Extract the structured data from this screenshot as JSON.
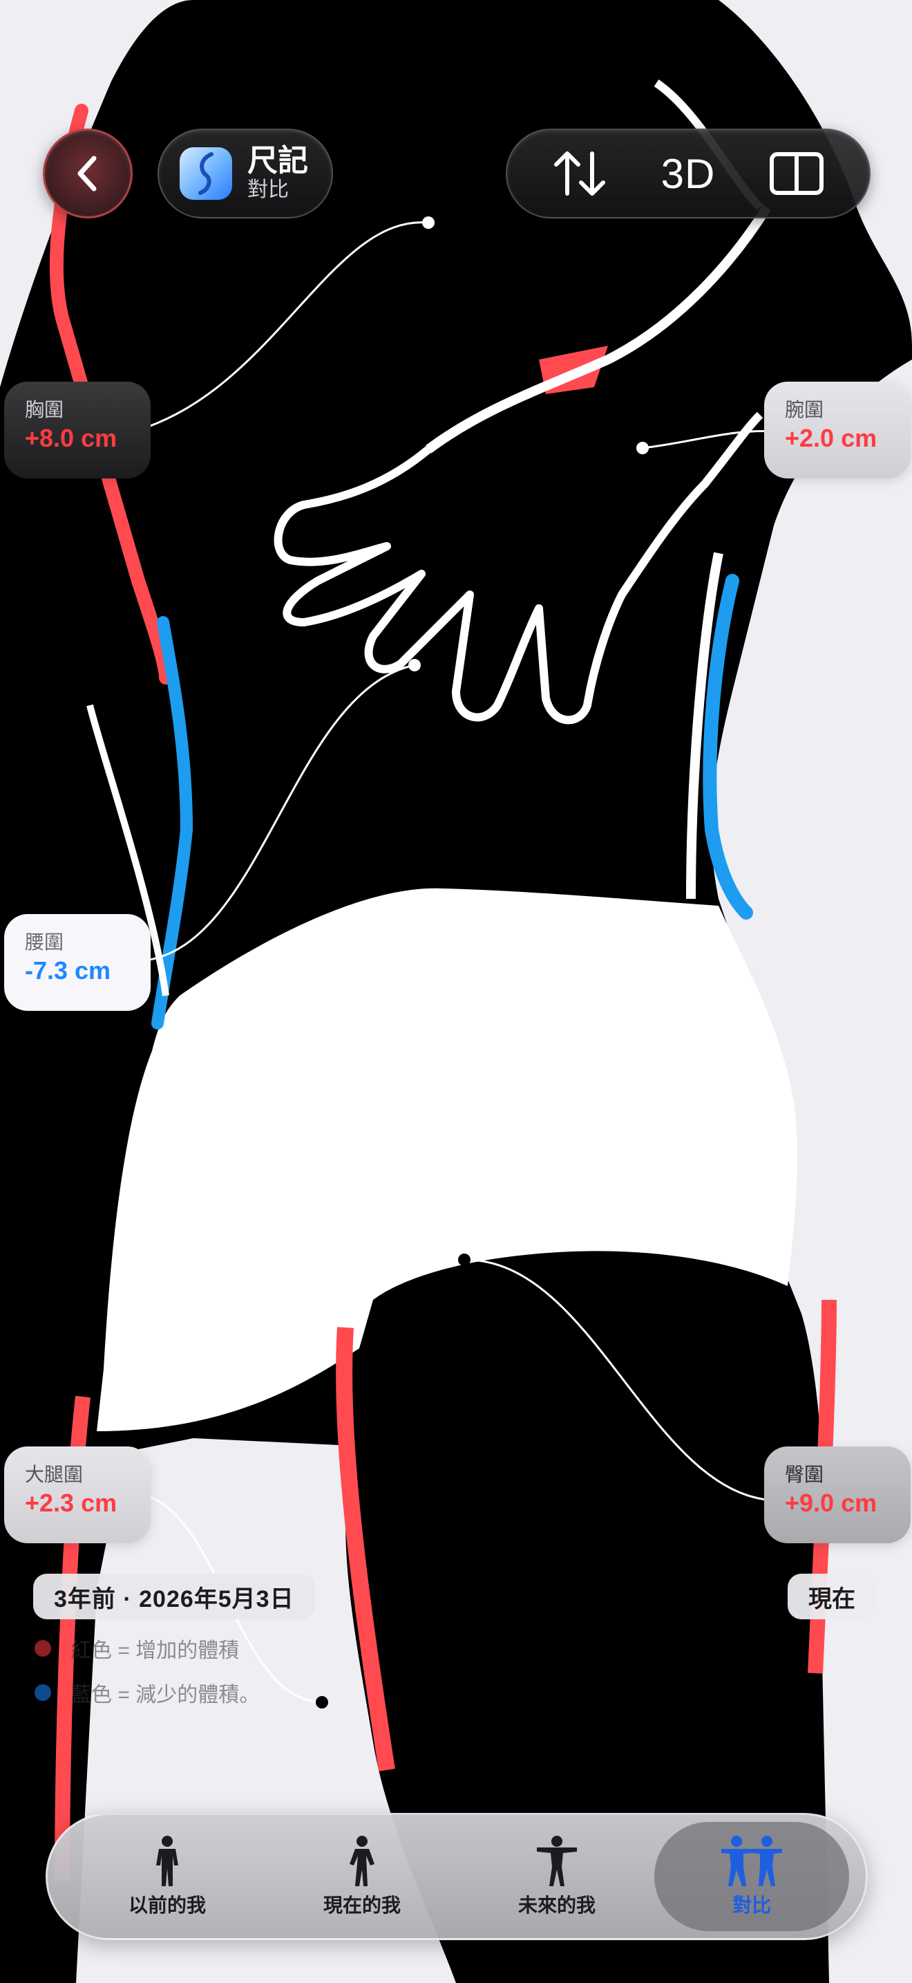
{
  "header": {
    "app_name": "尺記",
    "app_subtitle": "對比",
    "toolbar_3d_label": "3D"
  },
  "measurements": [
    {
      "label": "胸圍",
      "value": "+8.0 cm",
      "trend": "increase"
    },
    {
      "label": "腕圍",
      "value": "+2.0 cm",
      "trend": "increase"
    },
    {
      "label": "腰圍",
      "value": "-7.3 cm",
      "trend": "decrease"
    },
    {
      "label": "大腿圍",
      "value": "+2.3 cm",
      "trend": "increase"
    },
    {
      "label": "臀圍",
      "value": "+9.0 cm",
      "trend": "increase"
    }
  ],
  "comparison": {
    "past_label": "3年前 · 2026年5月3日",
    "current_label": "現在"
  },
  "legend": {
    "red": "紅色 = 增加的體積",
    "blue": "藍色 = 減少的體積。"
  },
  "tabs": [
    {
      "label": "以前的我",
      "icon": "person-icon",
      "active": false
    },
    {
      "label": "現在的我",
      "icon": "person-walking-icon",
      "active": false
    },
    {
      "label": "未來的我",
      "icon": "person-arms-up-icon",
      "active": false
    },
    {
      "label": "對比",
      "icon": "two-people-icon",
      "active": true
    }
  ],
  "colors": {
    "increase": "#ff3b42",
    "decrease": "#1e88ff",
    "active_tab": "#1d5fe0"
  }
}
